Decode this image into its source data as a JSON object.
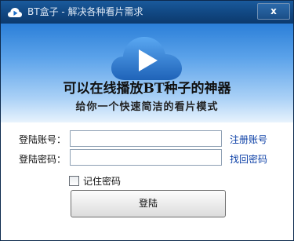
{
  "window": {
    "title": "BT盒子 - 解决各种看片需求",
    "close_label": "x"
  },
  "banner": {
    "slogan_primary": "可以在线播放BT种子的神器",
    "slogan_secondary": "给你一个快速简洁的看片模式"
  },
  "form": {
    "account_label": "登陆账号：",
    "account_value": "",
    "password_label": "登陆密码：",
    "password_value": "",
    "register_link": "注册账号",
    "recover_link": "找回密码",
    "remember_label": "记住密码",
    "remember_checked": false,
    "login_button": "登陆"
  },
  "colors": {
    "titlebar": "#124a86",
    "banner_top": "#2b7fd8",
    "link": "#0b3fa6"
  },
  "icons": {
    "app": "cloud-play-icon",
    "close": "close-icon",
    "logo": "cloud-play-logo"
  }
}
